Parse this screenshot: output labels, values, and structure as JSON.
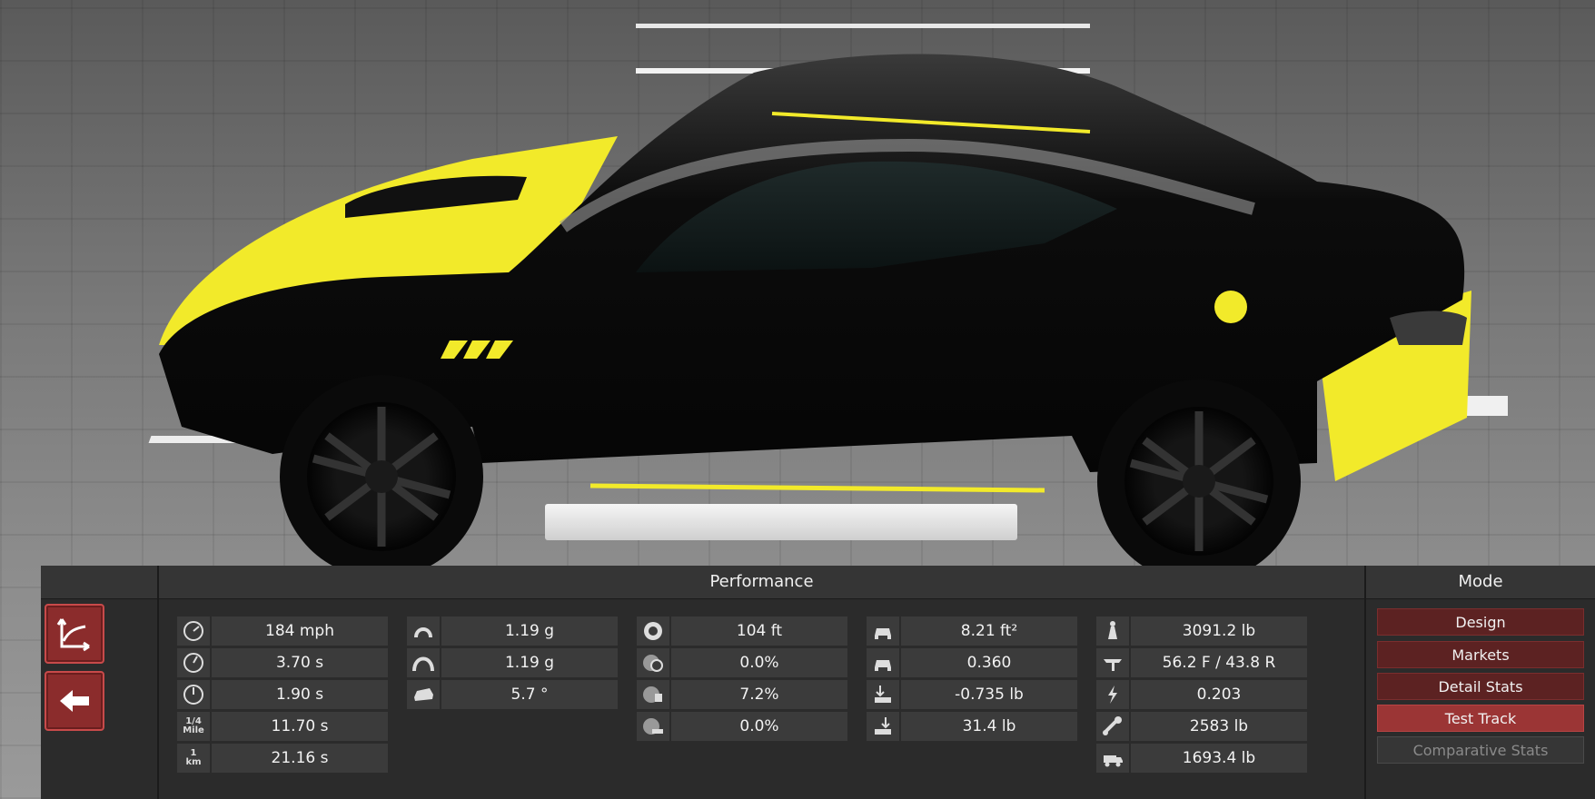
{
  "performance": {
    "title": "Performance",
    "columns": [
      [
        {
          "icon": "speedometer-top-speed-icon",
          "value": "184 mph"
        },
        {
          "icon": "speedometer-0-60-icon",
          "value": "3.70 s"
        },
        {
          "icon": "speedometer-0-100-icon",
          "value": "1.90 s"
        },
        {
          "icon": "quarter-mile-icon",
          "icon_text": "1/4 Mile",
          "value": "11.70 s"
        },
        {
          "icon": "one-km-icon",
          "icon_text": "1 km",
          "value": "21.16 s"
        }
      ],
      [
        {
          "icon": "cornering-grip-icon",
          "value": "1.19 g"
        },
        {
          "icon": "cornering-grip-high-icon",
          "value": "1.19 g"
        },
        {
          "icon": "body-roll-icon",
          "value": "5.7 °"
        }
      ],
      [
        {
          "icon": "braking-distance-icon",
          "value": "104 ft"
        },
        {
          "icon": "brake-steering-icon",
          "value": "0.0%"
        },
        {
          "icon": "brake-fade-icon",
          "value": "7.2%"
        },
        {
          "icon": "brake-lockup-icon",
          "value": "0.0%"
        }
      ],
      [
        {
          "icon": "frontal-area-icon",
          "value": "8.21 ft²"
        },
        {
          "icon": "drag-coefficient-icon",
          "value": "0.360"
        },
        {
          "icon": "front-downforce-icon",
          "value": "-0.735 lb"
        },
        {
          "icon": "rear-downforce-icon",
          "value": "31.4 lb"
        }
      ],
      [
        {
          "icon": "weight-icon",
          "value": "3091.2 lb"
        },
        {
          "icon": "weight-distribution-icon",
          "value": "56.2 F / 43.8 R"
        },
        {
          "icon": "power-to-weight-icon",
          "value": "0.203"
        },
        {
          "icon": "towing-capacity-icon",
          "value": "2583 lb"
        },
        {
          "icon": "cargo-capacity-icon",
          "value": "1693.4 lb"
        }
      ]
    ]
  },
  "mode": {
    "title": "Mode",
    "buttons": [
      {
        "label": "Design",
        "state": "normal"
      },
      {
        "label": "Markets",
        "state": "normal"
      },
      {
        "label": "Detail Stats",
        "state": "normal"
      },
      {
        "label": "Test Track",
        "state": "active"
      },
      {
        "label": "Comparative Stats",
        "state": "disabled"
      }
    ]
  },
  "left_buttons": [
    {
      "icon": "graph-axes-icon"
    },
    {
      "icon": "back-arrow-icon"
    }
  ],
  "car": {
    "body_color": "#0a0a0a",
    "accent_color": "#f2ea2a"
  }
}
